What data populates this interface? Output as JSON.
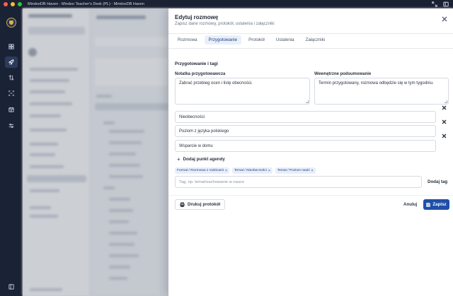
{
  "window": {
    "title": "MindooDB Haven - Mindoo Teacher's Desk (PL) - MindooDB Haven"
  },
  "drawer": {
    "title": "Edytuj rozmowę",
    "subtitle": "Zapisz dane rozmowy, protokół, ustalenia i załączniki",
    "tabs": [
      {
        "label": "Rozmowa",
        "active": false
      },
      {
        "label": "Przygotowanie",
        "active": true
      },
      {
        "label": "Protokół",
        "active": false
      },
      {
        "label": "Ustalenia",
        "active": false
      },
      {
        "label": "Załączniki",
        "active": false
      }
    ],
    "section_title": "Przygotowanie i tagi",
    "prep_note": {
      "label": "Notatka przygotowawcza",
      "value": "Zabrać przebieg ocen i listę obecności."
    },
    "internal_summary": {
      "label": "Wewnętrzne podsumowanie",
      "value": "Termin przygotowany, rozmowa odbędzie się w tym tygodniu."
    },
    "agenda": [
      {
        "value": "Nieobecności"
      },
      {
        "value": "Poziom z języka polskiego"
      },
      {
        "value": "Wsparcie w domu"
      }
    ],
    "add_agenda_label": "Dodaj punkt agendy",
    "tags": [
      {
        "label": "Format / Rozmowa z rodzicami"
      },
      {
        "label": "Temat / Nieobecności"
      },
      {
        "label": "Temat / Poziom nauki"
      }
    ],
    "tag_input": {
      "placeholder": "Tag, np. temat/zachowanie w nauce",
      "value": ""
    },
    "add_tag_label": "Dodaj tag",
    "print_label": "Drukuj protokół",
    "cancel_label": "Anuluj",
    "save_label": "Zapisz"
  }
}
